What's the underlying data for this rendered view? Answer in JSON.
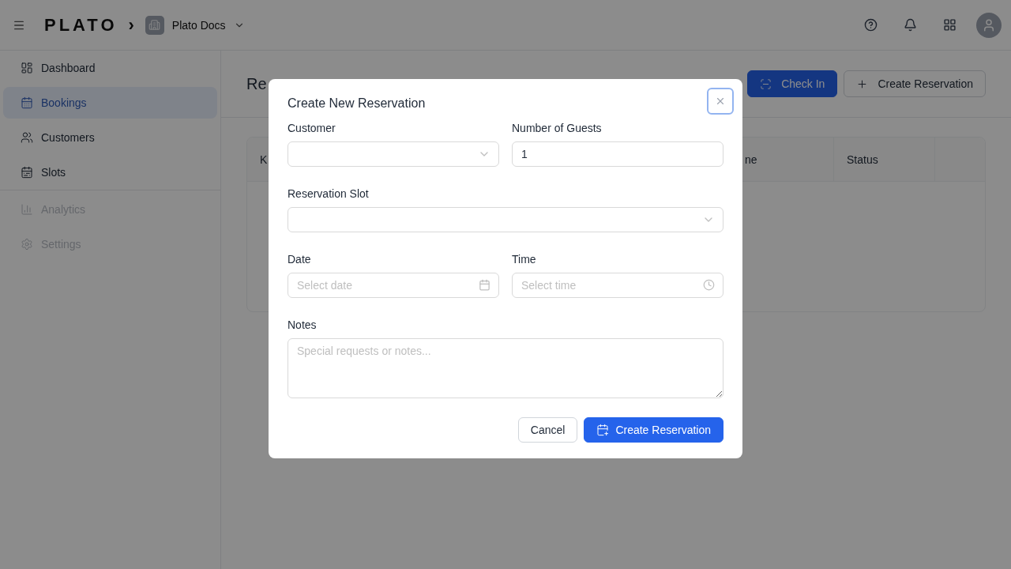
{
  "header": {
    "logo": "PLATO",
    "breadcrumb_separator": "›",
    "workspace": "Plato Docs"
  },
  "sidebar": {
    "groups": [
      [
        {
          "label": "Dashboard",
          "selected": false,
          "disabled": false
        },
        {
          "label": "Bookings",
          "selected": true,
          "disabled": false
        },
        {
          "label": "Customers",
          "selected": false,
          "disabled": false
        },
        {
          "label": "Slots",
          "selected": false,
          "disabled": false
        }
      ],
      [
        {
          "label": "Analytics",
          "selected": false,
          "disabled": true
        },
        {
          "label": "Settings",
          "selected": false,
          "disabled": true
        }
      ]
    ]
  },
  "page": {
    "title": "Re",
    "actions": [
      {
        "label": "Check In",
        "kind": "primary"
      },
      {
        "label": "Create Reservation",
        "kind": "secondary"
      }
    ],
    "table": {
      "columns": [
        "K",
        "ne",
        "Status",
        ""
      ]
    }
  },
  "modal": {
    "title": "Create New Reservation",
    "rows": [
      [
        {
          "label": "Customer",
          "kind": "select"
        },
        {
          "label": "Number of Guests",
          "kind": "number",
          "value": "1"
        }
      ],
      [
        {
          "label": "Reservation Slot",
          "kind": "select"
        }
      ],
      [
        {
          "label": "Date",
          "kind": "date",
          "placeholder": "Select date"
        },
        {
          "label": "Time",
          "kind": "time",
          "placeholder": "Select time"
        }
      ],
      [
        {
          "label": "Notes",
          "kind": "textarea",
          "placeholder": "Special requests or notes..."
        }
      ]
    ],
    "buttons": [
      {
        "label": "Cancel",
        "kind": "secondary"
      },
      {
        "label": "Create Reservation",
        "kind": "primary"
      }
    ]
  }
}
